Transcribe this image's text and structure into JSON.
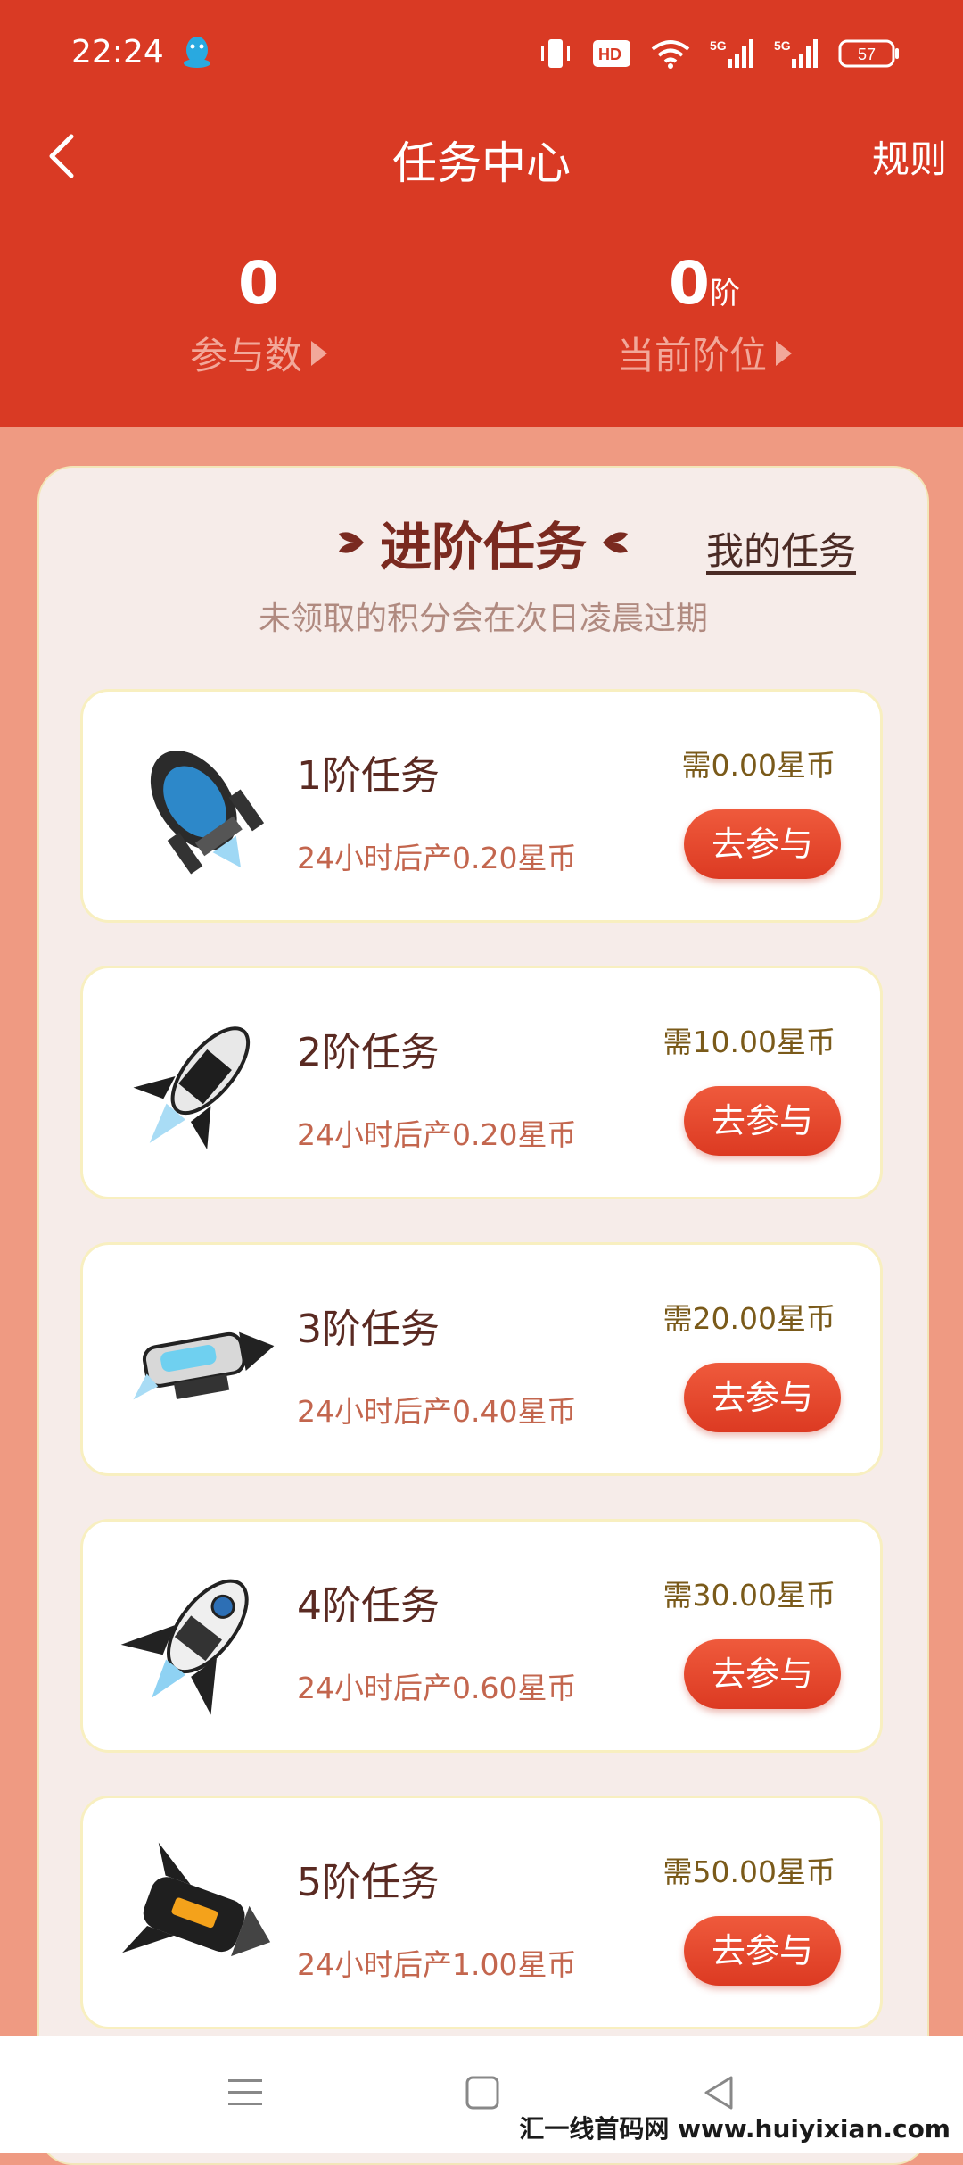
{
  "status_bar": {
    "time": "22:24",
    "network_badge": "HD",
    "signal_1": "5G",
    "signal_2": "5G",
    "battery": "57"
  },
  "nav": {
    "title": "任务中心",
    "rules": "规则"
  },
  "stats": [
    {
      "value": "0",
      "unit": "",
      "label": "参与数"
    },
    {
      "value": "0",
      "unit": "阶",
      "label": "当前阶位"
    }
  ],
  "section": {
    "title": "进阶任务",
    "my_tasks": "我的任务",
    "subtitle": "未领取的积分会在次日凌晨过期"
  },
  "tasks": [
    {
      "name": "1阶任务",
      "yield": "24小时后产0.20星币",
      "cost": "需0.00星币",
      "button": "去参与"
    },
    {
      "name": "2阶任务",
      "yield": "24小时后产0.20星币",
      "cost": "需10.00星币",
      "button": "去参与"
    },
    {
      "name": "3阶任务",
      "yield": "24小时后产0.40星币",
      "cost": "需20.00星币",
      "button": "去参与"
    },
    {
      "name": "4阶任务",
      "yield": "24小时后产0.60星币",
      "cost": "需30.00星币",
      "button": "去参与"
    },
    {
      "name": "5阶任务",
      "yield": "24小时后产1.00星币",
      "cost": "需50.00星币",
      "button": "去参与"
    }
  ],
  "watermark": "汇一线首码网 www.huiyixian.com",
  "colors": {
    "header": "#d93a24",
    "accent": "#e04a2f",
    "panel": "#f6ece9"
  }
}
